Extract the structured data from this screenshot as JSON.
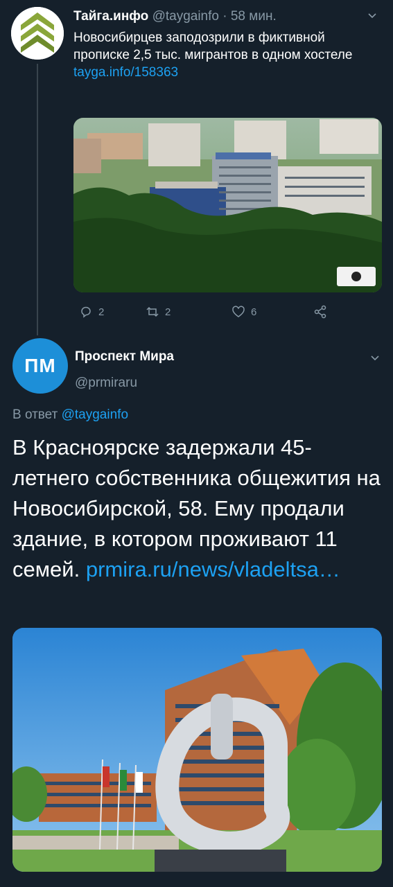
{
  "tweet1": {
    "author_name": "Тайга.инфо",
    "handle": "@taygainfo",
    "separator": "·",
    "time": "58 мин.",
    "text": "Новосибирцев заподозрили в фиктивной прописке 2,5 тыс. мигрантов в одном хостеле ",
    "link_text": "tayga.info/158363",
    "actions": {
      "replies": "2",
      "retweets": "2",
      "likes": "6"
    }
  },
  "tweet2": {
    "avatar_initials": "ПМ",
    "author_name": "Проспект Мира",
    "handle": "@prmiraru",
    "reply_prefix": "В ответ ",
    "reply_handle": "@taygainfo",
    "text": "В Красноярске задержали 45-летнего собственника общежития на Новосибирской, 58. Ему продали здание, в котором проживают 11 семей. ",
    "link_text": "prmira.ru/news/vladeltsa…"
  },
  "colors": {
    "background": "#15202b",
    "accent": "#1da1f2",
    "muted": "#8899a6",
    "avatar_pm": "#1d8fd8"
  },
  "icons": [
    "chevron-down-icon",
    "reply-icon",
    "retweet-icon",
    "like-icon",
    "share-icon"
  ]
}
